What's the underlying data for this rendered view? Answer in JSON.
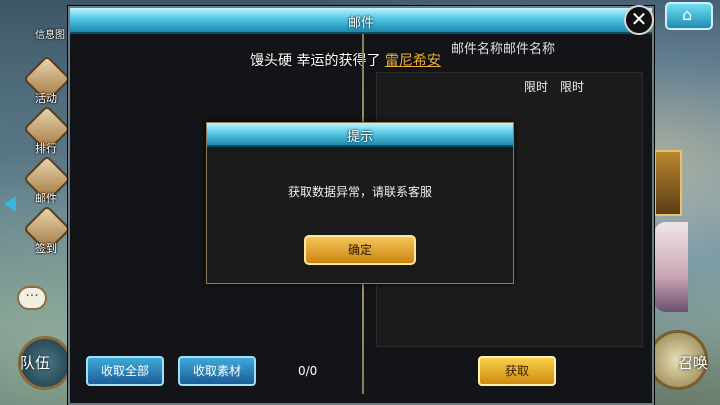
{
  "window": {
    "title": "邮件"
  },
  "announcement": {
    "prefix": "馒头硬 幸运的获得了 ",
    "highlight": "雷尼希安"
  },
  "mail": {
    "name": "邮件名称邮件名称",
    "limit_1": "限时",
    "limit_2": "限时"
  },
  "buttons": {
    "collect_all": "收取全部",
    "collect_materials": "收取素材",
    "get": "获取"
  },
  "count": "0/0",
  "dialog": {
    "title": "提示",
    "message": "获取数据异常，请联系客服",
    "ok": "确定"
  },
  "sidebar": {
    "top_label": "信息图",
    "items": [
      {
        "label": "活动"
      },
      {
        "label": "排行"
      },
      {
        "label": "邮件"
      },
      {
        "label": "签到"
      }
    ]
  },
  "bottom": {
    "left_label": "队伍",
    "right_label": "召唤"
  },
  "icons": {
    "close": "close-icon",
    "home": "home-icon",
    "chat": "chat-icon",
    "sidebar_arrow": "left-arrow-icon"
  },
  "colors": {
    "header_cyan": "#52c6e3",
    "highlight_gold": "#f2b33b",
    "button_blue": "#1d5d99",
    "button_gold": "#d18b10"
  }
}
